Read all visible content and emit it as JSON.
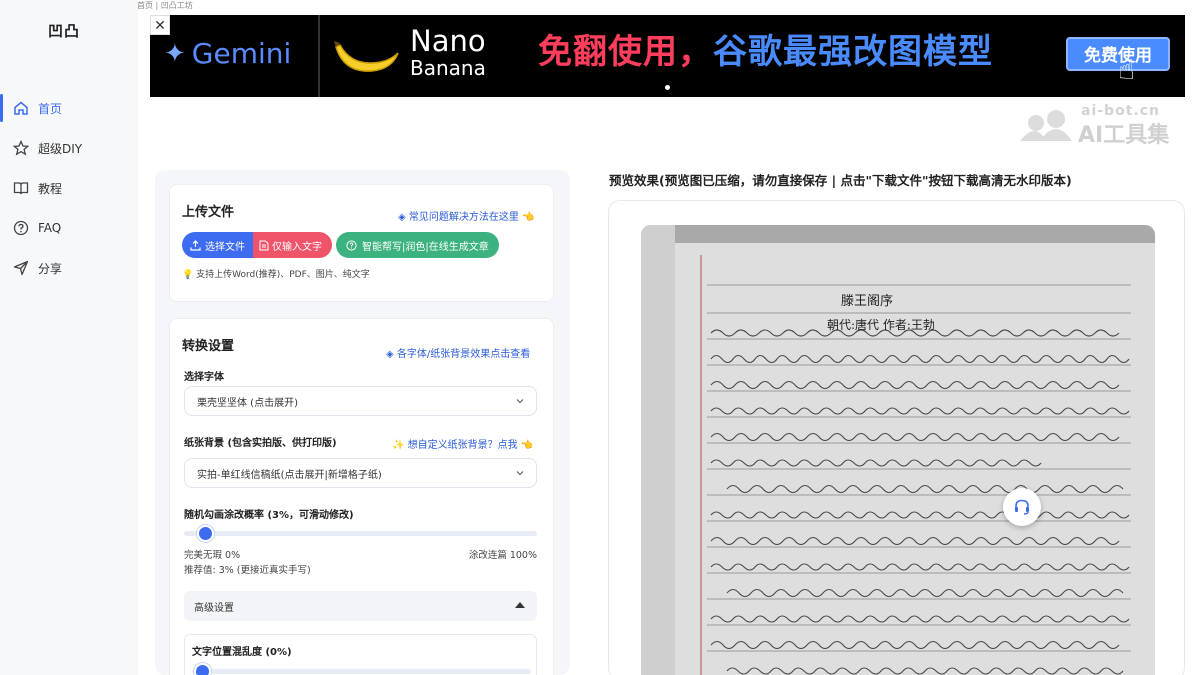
{
  "sidebar": {
    "logo": "凹凸",
    "items": [
      {
        "label": "首页",
        "icon": "home-icon",
        "active": true
      },
      {
        "label": "超级DIY",
        "icon": "star-icon",
        "active": false
      },
      {
        "label": "教程",
        "icon": "book-icon",
        "active": false
      },
      {
        "label": "FAQ",
        "icon": "question-icon",
        "active": false
      },
      {
        "label": "分享",
        "icon": "share-icon",
        "active": false
      }
    ]
  },
  "breadcrumb": "首页 | 凹凸工坊",
  "banner": {
    "close": "✕",
    "brand": "Gemini",
    "nano_line1": "Nano",
    "nano_line2": "Banana",
    "slogan_red": "免翻使用，",
    "slogan_blue": "谷歌最强改图模型",
    "cta": "免费使用"
  },
  "watermark": {
    "small": "ai-bot.cn",
    "big": "AI工具集"
  },
  "upload": {
    "title": "上传文件",
    "faq_link": "常见问题解决方法在这里",
    "btn_choose": "选择文件",
    "btn_text_only": "仅输入文字",
    "btn_ai": "智能帮写|润色|在线生成文章",
    "hint": "支持上传Word(推荐)、PDF、图片、纯文字"
  },
  "settings": {
    "title": "转换设置",
    "font_link": "各字体/纸张背景效果点击查看",
    "font_label": "选择字体",
    "font_value": "栗壳坚坚体 (点击展开)",
    "paper_label": "纸张背景 (包含实拍版、供打印版)",
    "paper_link": "想自定义纸张背景？点我",
    "paper_value": "实拍-单红线信稿纸(点击展开|新增格子纸)",
    "prob_label": "随机勾画涂改概率 (3%，可滑动修改)",
    "prob_value": 3,
    "prob_min_label": "完美无瑕 0%",
    "prob_max_label": "涂改连篇 100%",
    "prob_recommend": "推荐值: 3% (更接近真实手写)",
    "advanced_label": "高级设置",
    "position_label": "文字位置混乱度 (0%)",
    "position_value": 0
  },
  "preview": {
    "title": "预览效果(预览图已压缩，请勿直接保存 | 点击\"下载文件\"按钮下载高清无水印版本)",
    "doc_title": "滕王阁序",
    "doc_author": "朝代:唐代 作者:王勃"
  }
}
